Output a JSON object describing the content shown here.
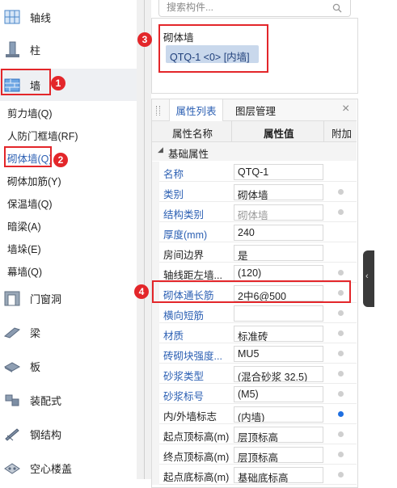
{
  "colors": {
    "accent": "#2b5fb3",
    "annotation_red": "#e3262a",
    "selected_bg": "#eef0f3"
  },
  "nav": {
    "categories": [
      {
        "label": "轴线",
        "icon": "axis-grid-icon"
      },
      {
        "label": "柱",
        "icon": "column-icon"
      },
      {
        "label": "墙",
        "icon": "wall-icon"
      },
      {
        "label": "门窗洞",
        "icon": "door-window-icon"
      },
      {
        "label": "梁",
        "icon": "beam-icon"
      },
      {
        "label": "板",
        "icon": "slab-icon"
      },
      {
        "label": "装配式",
        "icon": "prefab-icon"
      },
      {
        "label": "钢结构",
        "icon": "steel-structure-icon"
      },
      {
        "label": "空心楼盖",
        "icon": "hollow-floor-icon"
      }
    ],
    "wall_items": [
      "剪力墙(Q)",
      "人防门框墙(RF)",
      "砌体墙(Q)",
      "砌体加筋(Y)",
      "保温墙(Q)",
      "暗梁(A)",
      "墙垛(E)",
      "幕墙(Q)"
    ]
  },
  "badges": [
    "1",
    "2",
    "3",
    "4"
  ],
  "search": {
    "placeholder": "搜索构件..."
  },
  "component_list": {
    "group_title": "砌体墙",
    "selected_item": "QTQ-1 <0> [内墙]"
  },
  "props": {
    "tabs": [
      "属性列表",
      "图层管理"
    ],
    "close_glyph": "×",
    "headers": [
      "属性名称",
      "属性值",
      "附加"
    ],
    "section": "基础属性",
    "rows": [
      {
        "name": "名称",
        "value": "QTQ-1",
        "blue": true,
        "grey": false,
        "dot": "none"
      },
      {
        "name": "类别",
        "value": "砌体墙",
        "blue": true,
        "grey": false,
        "dot": "grey"
      },
      {
        "name": "结构类别",
        "value": "砌体墙",
        "blue": true,
        "grey": true,
        "dot": "grey"
      },
      {
        "name": "厚度(mm)",
        "value": "240",
        "blue": true,
        "grey": false,
        "dot": "none"
      },
      {
        "name": "房间边界",
        "value": "是",
        "blue": false,
        "grey": false,
        "dot": "none"
      },
      {
        "name": "轴线距左墙...",
        "value": "(120)",
        "blue": false,
        "grey": false,
        "dot": "grey"
      },
      {
        "name": "砌体通长筋",
        "value": "2中6@500",
        "blue": true,
        "grey": false,
        "dot": "grey"
      },
      {
        "name": "横向短筋",
        "value": "",
        "blue": true,
        "grey": false,
        "dot": "grey"
      },
      {
        "name": "材质",
        "value": "标准砖",
        "blue": true,
        "grey": false,
        "dot": "grey"
      },
      {
        "name": "砖砌块强度...",
        "value": "MU5",
        "blue": true,
        "grey": false,
        "dot": "grey"
      },
      {
        "name": "砂浆类型",
        "value": "(混合砂浆  32.5)",
        "blue": true,
        "grey": false,
        "dot": "grey"
      },
      {
        "name": "砂浆标号",
        "value": "(M5)",
        "blue": true,
        "grey": false,
        "dot": "grey"
      },
      {
        "name": "内/外墙标志",
        "value": "(内墙)",
        "blue": false,
        "grey": false,
        "dot": "blue"
      },
      {
        "name": "起点顶标高(m)",
        "value": "层顶标高",
        "blue": false,
        "grey": false,
        "dot": "grey"
      },
      {
        "name": "终点顶标高(m)",
        "value": "层顶标高",
        "blue": false,
        "grey": false,
        "dot": "grey"
      },
      {
        "name": "起点底标高(m)",
        "value": "基础底标高",
        "blue": false,
        "grey": false,
        "dot": "grey"
      }
    ]
  }
}
